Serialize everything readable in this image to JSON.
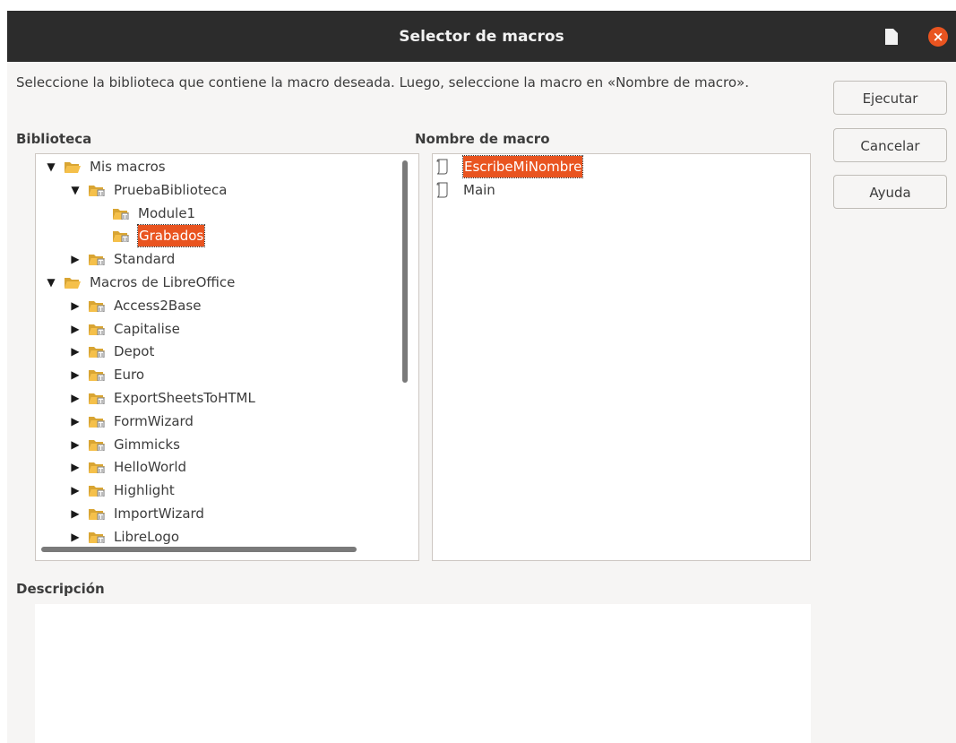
{
  "window": {
    "title": "Selector de macros"
  },
  "intro": "Seleccione la biblioteca que contiene la macro deseada. Luego, seleccione la macro en «Nombre de macro».",
  "labels": {
    "library": "Biblioteca",
    "macro_name": "Nombre de macro",
    "description": "Descripción"
  },
  "buttons": {
    "run": "Ejecutar",
    "cancel": "Cancelar",
    "help": "Ayuda"
  },
  "library_tree": [
    {
      "label": "Mis macros",
      "level": 0,
      "expanded": true,
      "icon": "folder-open-icon"
    },
    {
      "label": "PruebaBiblioteca",
      "level": 1,
      "expanded": true,
      "icon": "folder-library-icon"
    },
    {
      "label": "Module1",
      "level": 2,
      "icon": "folder-library-icon"
    },
    {
      "label": "Grabados",
      "level": 2,
      "icon": "folder-library-icon",
      "selected": true
    },
    {
      "label": "Standard",
      "level": 1,
      "expanded": false,
      "icon": "folder-library-icon"
    },
    {
      "label": "Macros de LibreOffice",
      "level": 0,
      "expanded": true,
      "icon": "folder-open-icon"
    },
    {
      "label": "Access2Base",
      "level": 1,
      "expanded": false,
      "icon": "folder-library-icon"
    },
    {
      "label": "Capitalise",
      "level": 1,
      "expanded": false,
      "icon": "folder-library-icon"
    },
    {
      "label": "Depot",
      "level": 1,
      "expanded": false,
      "icon": "folder-library-icon"
    },
    {
      "label": "Euro",
      "level": 1,
      "expanded": false,
      "icon": "folder-library-icon"
    },
    {
      "label": "ExportSheetsToHTML",
      "level": 1,
      "expanded": false,
      "icon": "folder-library-icon"
    },
    {
      "label": "FormWizard",
      "level": 1,
      "expanded": false,
      "icon": "folder-library-icon"
    },
    {
      "label": "Gimmicks",
      "level": 1,
      "expanded": false,
      "icon": "folder-library-icon"
    },
    {
      "label": "HelloWorld",
      "level": 1,
      "expanded": false,
      "icon": "folder-library-icon"
    },
    {
      "label": "Highlight",
      "level": 1,
      "expanded": false,
      "icon": "folder-library-icon"
    },
    {
      "label": "ImportWizard",
      "level": 1,
      "expanded": false,
      "icon": "folder-library-icon"
    },
    {
      "label": "LibreLogo",
      "level": 1,
      "expanded": false,
      "icon": "folder-library-icon"
    }
  ],
  "macros": [
    {
      "label": "EscribeMiNombre",
      "icon": "macro-script-icon",
      "selected": true
    },
    {
      "label": "Main",
      "icon": "macro-script-icon"
    }
  ],
  "colors": {
    "accent": "#e95420",
    "titlebar": "#2c2c2c",
    "folder": "#f5c04a"
  }
}
